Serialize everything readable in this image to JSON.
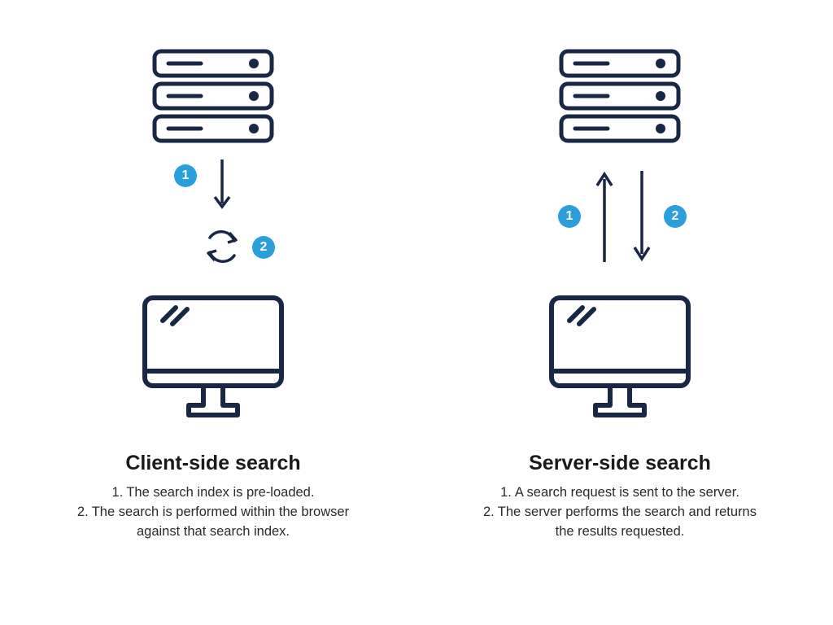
{
  "colors": {
    "stroke": "#1a2744",
    "accent": "#2b9fdc",
    "bg": "#ffffff"
  },
  "left": {
    "title": "Client-side search",
    "steps": [
      "The search index is pre-loaded.",
      "The search is performed within the browser against that search index."
    ],
    "badge1": "1",
    "badge2": "2"
  },
  "right": {
    "title": "Server-side search",
    "steps": [
      "A search request is sent to the server.",
      "The server performs the search and returns the results requested."
    ],
    "badge1": "1",
    "badge2": "2"
  }
}
